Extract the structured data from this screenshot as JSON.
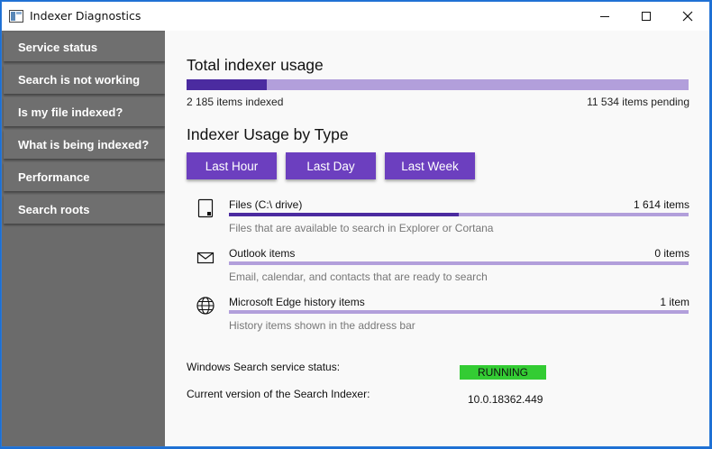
{
  "window": {
    "title": "Indexer Diagnostics",
    "controls": [
      "minimize-icon",
      "maximize-icon",
      "close-icon"
    ]
  },
  "sidebar": {
    "items": [
      {
        "label": "Service status"
      },
      {
        "label": "Search is not working"
      },
      {
        "label": "Is my file indexed?"
      },
      {
        "label": "What is being indexed?"
      },
      {
        "label": "Performance"
      },
      {
        "label": "Search roots"
      }
    ]
  },
  "usage": {
    "title": "Total indexer usage",
    "indexed": "2 185 items indexed",
    "pending": "11 534 items pending",
    "progress_fraction": 0.159
  },
  "by_type": {
    "title": "Indexer Usage by Type",
    "buttons": [
      "Last Hour",
      "Last Day",
      "Last Week"
    ],
    "rows": [
      {
        "icon": "tablet-icon",
        "title": "Files (C:\\ drive)",
        "count": "1 614 items",
        "desc": "Files that are available to search in Explorer or Cortana",
        "fill": 0.5
      },
      {
        "icon": "mail-icon",
        "title": "Outlook items",
        "count": "0 items",
        "desc": "Email, calendar, and contacts that are ready to search",
        "fill": 0
      },
      {
        "icon": "globe-icon",
        "title": "Microsoft Edge history items",
        "count": "1 item",
        "desc": "History items shown in the address bar",
        "fill": 0
      }
    ]
  },
  "status": {
    "service_label": "Windows Search service status:",
    "service_value": "RUNNING",
    "service_color": "#33cc33",
    "version_label": "Current version of the Search Indexer:",
    "version_value": "10.0.18362.449"
  },
  "colors": {
    "accent": "#6c3fbf",
    "bar_fill": "#4b2ba0",
    "bar_track": "#b29fdb",
    "sidebar": "#6b6b6b"
  }
}
